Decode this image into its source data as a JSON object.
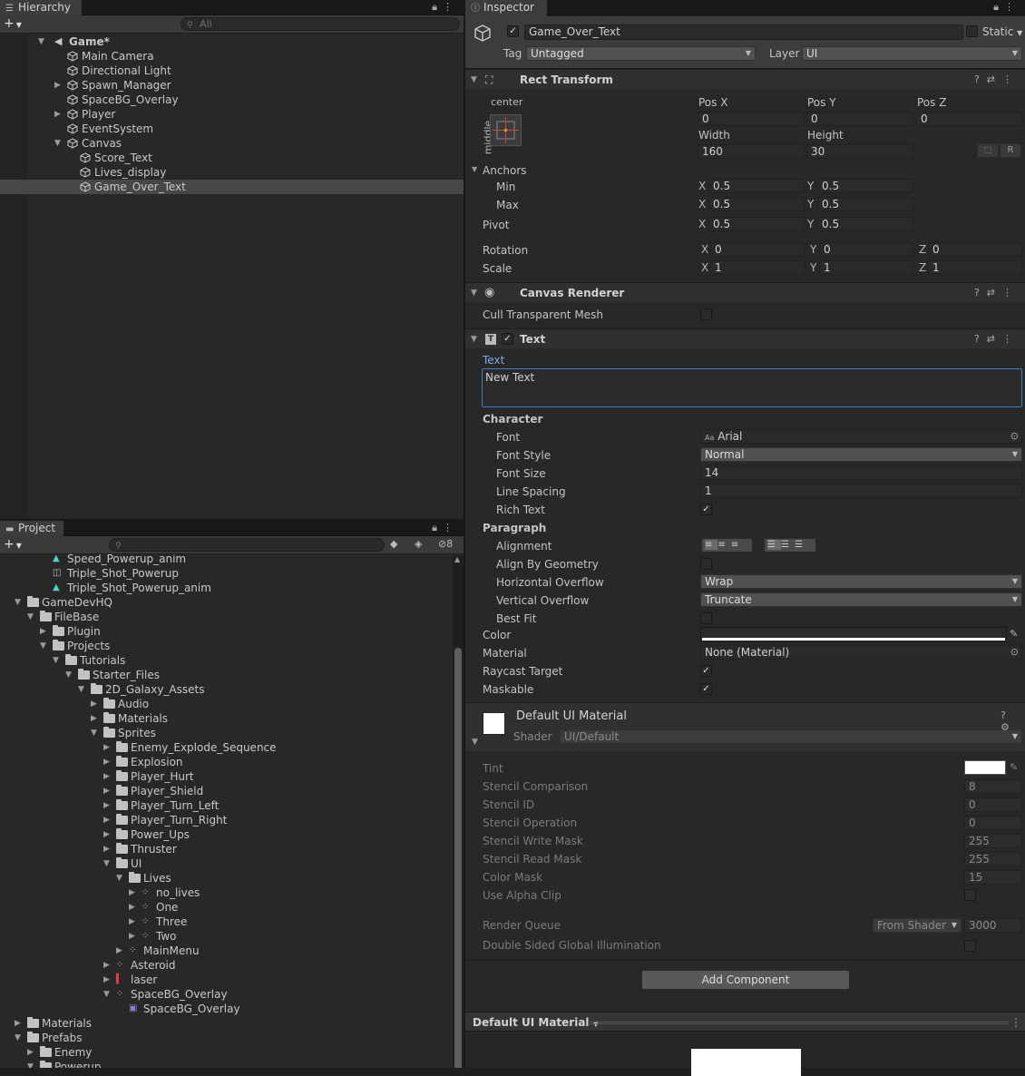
{
  "hierarchy": {
    "tab": "Hierarchy",
    "search_placeholder": "All",
    "items": [
      {
        "label": "Game*",
        "depth": 0,
        "arrow": "down",
        "bold": true
      },
      {
        "label": "Main Camera",
        "depth": 1,
        "arrow": ""
      },
      {
        "label": "Directional Light",
        "depth": 1,
        "arrow": ""
      },
      {
        "label": "Spawn_Manager",
        "depth": 1,
        "arrow": "right"
      },
      {
        "label": "SpaceBG_Overlay",
        "depth": 1,
        "arrow": ""
      },
      {
        "label": "Player",
        "depth": 1,
        "arrow": "right"
      },
      {
        "label": "EventSystem",
        "depth": 1,
        "arrow": ""
      },
      {
        "label": "Canvas",
        "depth": 1,
        "arrow": "down"
      },
      {
        "label": "Score_Text",
        "depth": 2,
        "arrow": ""
      },
      {
        "label": "Lives_display",
        "depth": 2,
        "arrow": ""
      },
      {
        "label": "Game_Over_Text",
        "depth": 2,
        "arrow": "",
        "selected": true
      }
    ]
  },
  "project": {
    "tab": "Project",
    "hidden_count": "8",
    "items": [
      {
        "label": "Speed_Powerup_anim",
        "depth": 2,
        "arrow": "",
        "icon": "anim"
      },
      {
        "label": "Triple_Shot_Powerup",
        "depth": 2,
        "arrow": "",
        "icon": "prefab"
      },
      {
        "label": "Triple_Shot_Powerup_anim",
        "depth": 2,
        "arrow": "",
        "icon": "anim"
      },
      {
        "label": "GameDevHQ",
        "depth": 0,
        "arrow": "down",
        "icon": "folder"
      },
      {
        "label": "FileBase",
        "depth": 1,
        "arrow": "down",
        "icon": "folder"
      },
      {
        "label": "Plugin",
        "depth": 2,
        "arrow": "right",
        "icon": "folder"
      },
      {
        "label": "Projects",
        "depth": 2,
        "arrow": "down",
        "icon": "folder"
      },
      {
        "label": "Tutorials",
        "depth": 3,
        "arrow": "down",
        "icon": "folder"
      },
      {
        "label": "Starter_Files",
        "depth": 4,
        "arrow": "down",
        "icon": "folder"
      },
      {
        "label": "2D_Galaxy_Assets",
        "depth": 5,
        "arrow": "down",
        "icon": "folder"
      },
      {
        "label": "Audio",
        "depth": 6,
        "arrow": "right",
        "icon": "folder"
      },
      {
        "label": "Materials",
        "depth": 6,
        "arrow": "right",
        "icon": "folder"
      },
      {
        "label": "Sprites",
        "depth": 6,
        "arrow": "down",
        "icon": "folder"
      },
      {
        "label": "Enemy_Explode_Sequence",
        "depth": 7,
        "arrow": "right",
        "icon": "folder"
      },
      {
        "label": "Explosion",
        "depth": 7,
        "arrow": "right",
        "icon": "folder"
      },
      {
        "label": "Player_Hurt",
        "depth": 7,
        "arrow": "right",
        "icon": "folder"
      },
      {
        "label": "Player_Shield",
        "depth": 7,
        "arrow": "right",
        "icon": "folder"
      },
      {
        "label": "Player_Turn_Left",
        "depth": 7,
        "arrow": "right",
        "icon": "folder"
      },
      {
        "label": "Player_Turn_Right",
        "depth": 7,
        "arrow": "right",
        "icon": "folder"
      },
      {
        "label": "Power_Ups",
        "depth": 7,
        "arrow": "right",
        "icon": "folder"
      },
      {
        "label": "Thruster",
        "depth": 7,
        "arrow": "right",
        "icon": "folder"
      },
      {
        "label": "UI",
        "depth": 7,
        "arrow": "down",
        "icon": "folder"
      },
      {
        "label": "Lives",
        "depth": 8,
        "arrow": "down",
        "icon": "folder"
      },
      {
        "label": "no_lives",
        "depth": 9,
        "arrow": "right",
        "icon": "sprite"
      },
      {
        "label": "One",
        "depth": 9,
        "arrow": "right",
        "icon": "sprite"
      },
      {
        "label": "Three",
        "depth": 9,
        "arrow": "right",
        "icon": "sprite"
      },
      {
        "label": "Two",
        "depth": 9,
        "arrow": "right",
        "icon": "sprite"
      },
      {
        "label": "MainMenu",
        "depth": 8,
        "arrow": "right",
        "icon": "sprite"
      },
      {
        "label": "Asteroid",
        "depth": 7,
        "arrow": "right",
        "icon": "sprite"
      },
      {
        "label": "laser",
        "depth": 7,
        "arrow": "right",
        "icon": "laser"
      },
      {
        "label": "SpaceBG_Overlay",
        "depth": 7,
        "arrow": "down",
        "icon": "sprite"
      },
      {
        "label": "SpaceBG_Overlay",
        "depth": 8,
        "arrow": "",
        "icon": "spriteitem"
      },
      {
        "label": "Materials",
        "depth": 0,
        "arrow": "right",
        "icon": "folder"
      },
      {
        "label": "Prefabs",
        "depth": 0,
        "arrow": "down",
        "icon": "folder"
      },
      {
        "label": "Enemy",
        "depth": 1,
        "arrow": "right",
        "icon": "folder"
      },
      {
        "label": "Powerup",
        "depth": 1,
        "arrow": "down",
        "icon": "folder"
      }
    ]
  },
  "inspector": {
    "tab": "Inspector",
    "object_name": "Game_Over_Text",
    "static_label": "Static",
    "tag_label": "Tag",
    "tag_value": "Untagged",
    "layer_label": "Layer",
    "layer_value": "UI",
    "rect": {
      "title": "Rect Transform",
      "anchor_h": "center",
      "anchor_v": "middle",
      "posx_label": "Pos X",
      "posy_label": "Pos Y",
      "posz_label": "Pos Z",
      "posx": "0",
      "posy": "0",
      "posz": "0",
      "width_label": "Width",
      "height_label": "Height",
      "width": "160",
      "height": "30",
      "r_button": "R",
      "anchors_label": "Anchors",
      "min_label": "Min",
      "max_label": "Max",
      "pivot_label": "Pivot",
      "min_x": "0.5",
      "min_y": "0.5",
      "max_x": "0.5",
      "max_y": "0.5",
      "pivot_x": "0.5",
      "pivot_y": "0.5",
      "rotation_label": "Rotation",
      "scale_label": "Scale",
      "rot_x": "0",
      "rot_y": "0",
      "rot_z": "0",
      "scale_x": "1",
      "scale_y": "1",
      "scale_z": "1",
      "x": "X",
      "y": "Y",
      "z": "Z"
    },
    "canvas_renderer": {
      "title": "Canvas Renderer",
      "cull_label": "Cull Transparent Mesh"
    },
    "text": {
      "title": "Text",
      "text_label": "Text",
      "text_value": "New Text",
      "character_label": "Character",
      "font_label": "Font",
      "font_value": "Arial",
      "font_style_label": "Font Style",
      "font_style_value": "Normal",
      "font_size_label": "Font Size",
      "font_size_value": "14",
      "line_spacing_label": "Line Spacing",
      "line_spacing_value": "1",
      "rich_text_label": "Rich Text",
      "paragraph_label": "Paragraph",
      "alignment_label": "Alignment",
      "align_geom_label": "Align By Geometry",
      "h_overflow_label": "Horizontal Overflow",
      "h_overflow_value": "Wrap",
      "v_overflow_label": "Vertical Overflow",
      "v_overflow_value": "Truncate",
      "best_fit_label": "Best Fit",
      "color_label": "Color",
      "material_label": "Material",
      "material_value": "None (Material)",
      "raycast_label": "Raycast Target",
      "maskable_label": "Maskable"
    },
    "material": {
      "name": "Default UI Material",
      "shader_label": "Shader",
      "shader_value": "UI/Default",
      "props": [
        {
          "label": "Tint",
          "value": ""
        },
        {
          "label": "Stencil Comparison",
          "value": "8"
        },
        {
          "label": "Stencil ID",
          "value": "0"
        },
        {
          "label": "Stencil Operation",
          "value": "0"
        },
        {
          "label": "Stencil Write Mask",
          "value": "255"
        },
        {
          "label": "Stencil Read Mask",
          "value": "255"
        },
        {
          "label": "Color Mask",
          "value": "15"
        },
        {
          "label": "Use Alpha Clip",
          "value": ""
        }
      ],
      "render_queue_label": "Render Queue",
      "render_queue_mode": "From Shader",
      "render_queue_value": "3000",
      "double_sided_label": "Double Sided Global Illumination"
    },
    "add_component": "Add Component",
    "preview_label": "Default UI Material"
  }
}
